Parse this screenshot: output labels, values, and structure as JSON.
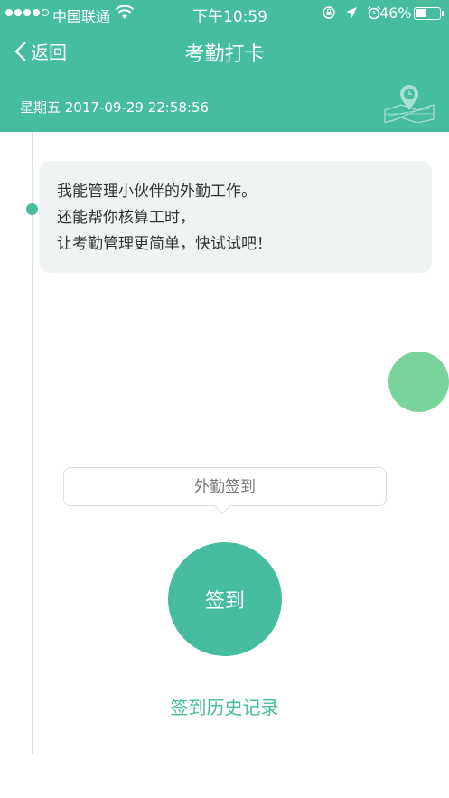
{
  "status_bar": {
    "carrier": "中国联通",
    "time": "下午10:59",
    "battery": "46%",
    "battery_level": 0.46,
    "icons": [
      "signal-dots",
      "wifi-icon",
      "rotation-lock-icon",
      "location-arrow-icon",
      "alarm-icon",
      "battery-icon"
    ]
  },
  "nav": {
    "back_label": "返回",
    "title": "考勤打卡"
  },
  "date_line": "星期五 2017-09-29 22:58:56",
  "intro_lines": [
    "我能管理小伙伴的外勤工作。",
    "还能帮你核算工时，",
    "让考勤管理更简单，快试试吧！"
  ],
  "tooltip_text": "外勤签到",
  "signin_button": "签到",
  "history_link": "签到历史记录",
  "colors": {
    "primary": "#45bd9e",
    "float_circle": "#79d49b",
    "bubble_bg": "#f0f3f4",
    "text_dark": "#333333"
  }
}
